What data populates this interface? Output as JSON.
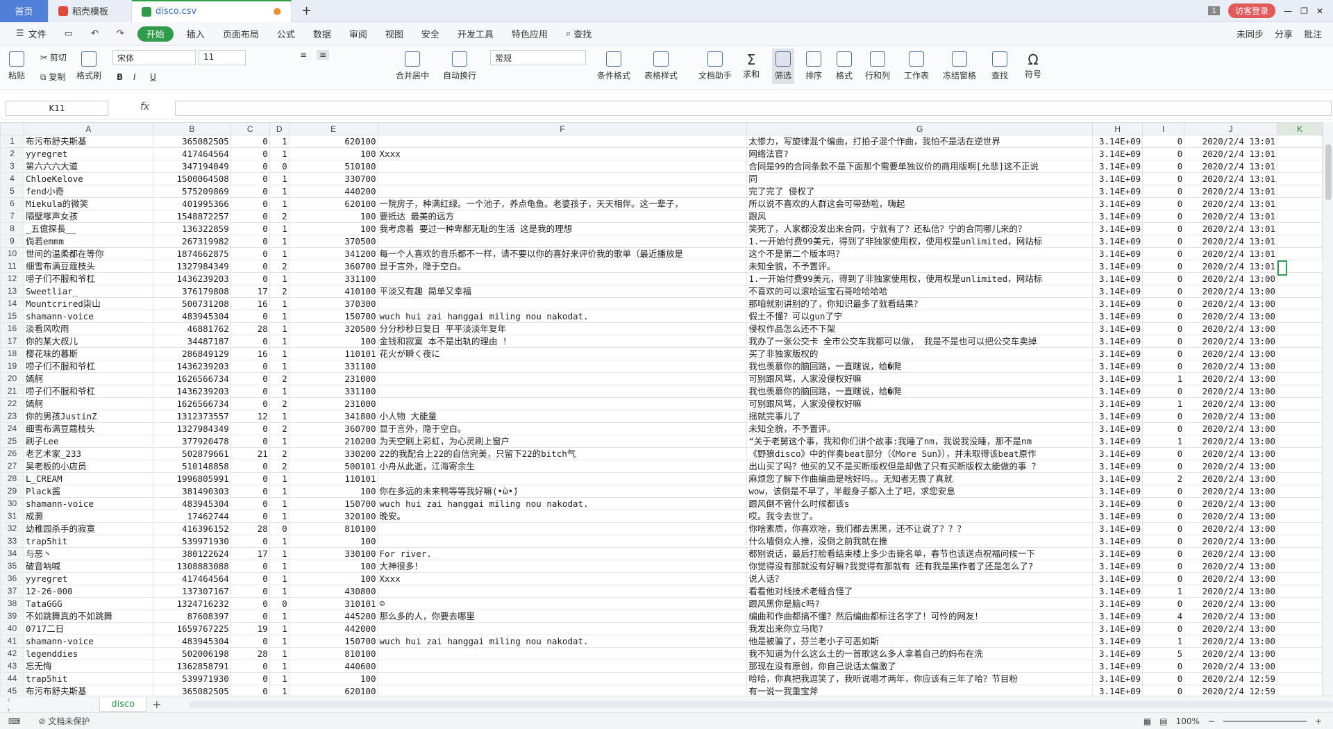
{
  "tabs": {
    "home": "首页",
    "template": "稻壳模板",
    "file": "disco.csv"
  },
  "titlebar": {
    "badge": "1",
    "login": "访客登录"
  },
  "menu": {
    "file": "文件",
    "items": [
      "开始",
      "插入",
      "页面布局",
      "公式",
      "数据",
      "审阅",
      "视图",
      "安全",
      "开发工具",
      "特色应用"
    ],
    "find": "查找",
    "right": [
      "未同步",
      "分享",
      "批注"
    ]
  },
  "ribbon": {
    "paste": "粘贴",
    "cut": "剪切",
    "copy": "复制",
    "format_painter": "格式刷",
    "font": "宋体",
    "size": "11",
    "number_format": "常规",
    "merge": "合并居中",
    "wrap": "自动换行",
    "cond": "条件格式",
    "table_fmt": "表格样式",
    "doc_helper": "文档助手",
    "sum": "求和",
    "filter": "筛选",
    "sort": "排序",
    "format": "格式",
    "rowcol": "行和列",
    "sheet": "工作表",
    "freeze": "冻结窗格",
    "find": "查找",
    "symbol": "符号"
  },
  "formula": {
    "namebox": "K11",
    "fx": "fx",
    "value": ""
  },
  "columns": [
    "A",
    "B",
    "C",
    "D",
    "E",
    "F",
    "G",
    "H",
    "I",
    "J",
    "K"
  ],
  "rows": [
    [
      "布污布舒夫斯基",
      "365082505",
      "0",
      "1",
      "620100",
      "",
      "太惨力，写旋律混个编曲，打拍子混个作曲，我怕不是活在逆世界",
      "3.14E+09",
      "0",
      "2020/2/4 13:01",
      ""
    ],
    [
      "yyregret",
      "417464564",
      "0",
      "1",
      "100",
      "Xxxx",
      "网络法官?",
      "3.14E+09",
      "0",
      "2020/2/4 13:01",
      ""
    ],
    [
      "第六六六大道",
      "347194049",
      "0",
      "0",
      "510100",
      "",
      "合同是99的合同条款不是下面那个需要单独议价的商用版啊[允悲]这不正说",
      "3.14E+09",
      "0",
      "2020/2/4 13:01",
      ""
    ],
    [
      "ChloeKelove",
      "1500064508",
      "0",
      "1",
      "330700",
      "",
      "同",
      "3.14E+09",
      "0",
      "2020/2/4 13:01",
      ""
    ],
    [
      "fend小奇",
      "575209869",
      "0",
      "1",
      "440200",
      "",
      "完了完了 侵权了",
      "3.14E+09",
      "0",
      "2020/2/4 13:01",
      ""
    ],
    [
      "Miekula的微笑",
      "401995366",
      "0",
      "1",
      "620100",
      "一院房子，种满红绿。一个池子，养点龟鱼。老婆孩子，天天相伴。这一辈子，",
      "所以说不喜欢的人群这会可带劲啦，嗨起",
      "3.14E+09",
      "0",
      "2020/2/4 13:01",
      ""
    ],
    [
      "隔壁嗲声女孩",
      "1548872257",
      "0",
      "2",
      "100",
      "要抵达 最美的远方",
      "跟风",
      "3.14E+09",
      "0",
      "2020/2/4 13:01",
      ""
    ],
    [
      "_五億探長__",
      "136322859",
      "0",
      "1",
      "100",
      "我考虑着 要过一种卑鄙无耻的生活 这是我的理想",
      "笑死了，人家都没发出来合同，宁就有了？还私信？宁的合同哪儿来的？",
      "3.14E+09",
      "0",
      "2020/2/4 13:01",
      ""
    ],
    [
      "倘若emmm",
      "267319982",
      "0",
      "1",
      "370500",
      "",
      "1.一开始付费99美元，得到了非独家使用权，使用权是unlimited，网站标",
      "3.14E+09",
      "0",
      "2020/2/4 13:01",
      ""
    ],
    [
      "世间的温柔都在等你",
      "1874662875",
      "0",
      "1",
      "341200",
      "每一个人喜欢的音乐都不一样，请不要以你的喜好来评价我的歌单（最近播放是",
      "这个不是第二个版本吗？",
      "3.14E+09",
      "0",
      "2020/2/4 13:01",
      ""
    ],
    [
      "细雪布满豆蔻枝头",
      "1327984349",
      "0",
      "2",
      "360700",
      "显于言外，隐于空白。",
      "未知全貌，不予置评。",
      "3.14E+09",
      "0",
      "2020/2/4 13:01",
      ""
    ],
    [
      "唠子们不服和爷杠",
      "1436239203",
      "0",
      "1",
      "331100",
      "",
      "1.一开始付费99美元，得到了非独家使用权，使用权是unlimited，网站标",
      "3.14E+09",
      "0",
      "2020/2/4 13:00",
      ""
    ],
    [
      "Sweetliar_",
      "376179808",
      "17",
      "2",
      "410100",
      "平淡又有趣 简单又幸福",
      "不喜欢的可以滚哈运宝石哥哈哈哈哈",
      "3.14E+09",
      "0",
      "2020/2/4 13:00",
      ""
    ],
    [
      "Mountcrired柒山",
      "500731208",
      "16",
      "1",
      "370300",
      "",
      "那咱就别讲别的了，你知识最多了就看结果？",
      "3.14E+09",
      "0",
      "2020/2/4 13:00",
      ""
    ],
    [
      "shamann-voice",
      "483945304",
      "0",
      "1",
      "150700",
      "wuch hui zai hanggai miling nou nakodat.",
      "假土不懂？可以gun了宁",
      "3.14E+09",
      "0",
      "2020/2/4 13:00",
      ""
    ],
    [
      "淡看风吹雨",
      "46881762",
      "28",
      "1",
      "320500",
      "分分秒秒日复日 平平淡淡年复年",
      "侵权作品怎么还不下架",
      "3.14E+09",
      "0",
      "2020/2/4 13:00",
      ""
    ],
    [
      "你的某大叔儿",
      "34487187",
      "0",
      "1",
      "100",
      "金钱和寂寞 本不是出轨的理由 ！",
      "我办了一张公交卡 全市公交车我都可以做， 我是不是也可以把公交车卖掉",
      "3.14E+09",
      "0",
      "2020/2/4 13:00",
      ""
    ],
    [
      "樱花味的暮斯",
      "286849129",
      "16",
      "1",
      "110101",
      "花火が瞬く夜に",
      "买了非独家版权的",
      "3.14E+09",
      "0",
      "2020/2/4 13:00",
      ""
    ],
    [
      "唠子们不服和爷杠",
      "1436239203",
      "0",
      "1",
      "331100",
      "",
      "我也羡慕你的脑回路，一直瞎说，给�爬",
      "3.14E+09",
      "0",
      "2020/2/4 13:00",
      ""
    ],
    [
      "嫣舸",
      "1626566734",
      "0",
      "2",
      "231000",
      "",
      "可别跟风骂，人家没侵权好嘛",
      "3.14E+09",
      "1",
      "2020/2/4 13:00",
      ""
    ],
    [
      "唠子们不服和爷杠",
      "1436239203",
      "0",
      "1",
      "331100",
      "",
      "我也羡慕你的脑回路，一直瞎说，给�爬",
      "3.14E+09",
      "0",
      "2020/2/4 13:00",
      ""
    ],
    [
      "嫣舸",
      "1626566734",
      "0",
      "2",
      "231000",
      "",
      "可别跟风骂，人家没侵权好嘛",
      "3.14E+09",
      "1",
      "2020/2/4 13:00",
      ""
    ],
    [
      "你的男孩JustinZ",
      "1312373557",
      "12",
      "1",
      "341800",
      "小人物 大能量",
      "摇就完事儿了",
      "3.14E+09",
      "0",
      "2020/2/4 13:00",
      ""
    ],
    [
      "细雪布满豆蔻枝头",
      "1327984349",
      "0",
      "2",
      "360700",
      "显于言外，隐于空白。",
      "未知全貌，不予置评。",
      "3.14E+09",
      "0",
      "2020/2/4 13:00",
      ""
    ],
    [
      "刷子Lee",
      "377920478",
      "0",
      "1",
      "210200",
      "为天空刷上彩虹，为心灵刷上窗户",
      "“关于老舅这个事，我和你们讲个故事:我睡了nm，我说我没睡，那不是nm",
      "3.14E+09",
      "1",
      "2020/2/4 13:00",
      ""
    ],
    [
      "老艺术家_233",
      "502879661",
      "21",
      "2",
      "330200",
      "22的我配合上22的自信完美，只留下22的bitch气",
      "《野狼disco》中的伴奏beat部分（《More Sun》），并未取得该beat原作",
      "3.14E+09",
      "0",
      "2020/2/4 13:00",
      ""
    ],
    [
      "吴老板的小店员",
      "510148858",
      "0",
      "2",
      "500101",
      "小舟从此逝，江海寄余生",
      "出山买了吗？他买的又不是买断版权但是却做了只有买断版权太能做的事 ？",
      "3.14E+09",
      "0",
      "2020/2/4 13:00",
      ""
    ],
    [
      "L_CREAM",
      "1996805991",
      "0",
      "1",
      "110101",
      "",
      "麻烦您了解下作曲编曲是啥好吗。。无知者无畏了真就",
      "3.14E+09",
      "2",
      "2020/2/4 13:00",
      ""
    ],
    [
      "Plack酱",
      "381490303",
      "0",
      "1",
      "100",
      "你在多远的未来鸭等等我好嘛(•̀ω•́)",
      "wow，该倒是不早了，半截身子都入土了吧，求您安息",
      "3.14E+09",
      "0",
      "2020/2/4 13:00",
      ""
    ],
    [
      "shamann-voice",
      "483945304",
      "0",
      "1",
      "150700",
      "wuch hui zai hanggai miling nou nakodat.",
      "跟风倒不管什么时候都该s",
      "3.14E+09",
      "0",
      "2020/2/4 13:00",
      ""
    ],
    [
      "成灏",
      "17462744",
      "0",
      "1",
      "320100",
      "晚安。",
      "哎。我令去世了。",
      "3.14E+09",
      "0",
      "2020/2/4 13:00",
      ""
    ],
    [
      "幼稚园杀手的寂寞",
      "416396152",
      "28",
      "0",
      "810100",
      "",
      "你啥素质，你喜欢啥，我们都去黑黑，还不让说了？？？",
      "3.14E+09",
      "0",
      "2020/2/4 13:00",
      ""
    ],
    [
      "trap5hit",
      "539971930",
      "0",
      "1",
      "100",
      "",
      "什么墙倒众人推，没倒之前我就在推",
      "3.14E+09",
      "0",
      "2020/2/4 13:00",
      ""
    ],
    [
      "与恶丶",
      "380122624",
      "17",
      "1",
      "330100",
      "For river.",
      "都别说话，最后打脸看结束楼上多少击毙名单，春节也该送点祝福问候一下",
      "3.14E+09",
      "0",
      "2020/2/4 13:00",
      ""
    ],
    [
      "破音呐喊",
      "1308883088",
      "0",
      "1",
      "100",
      "大神很多！",
      "你觉得没有那就没有好嘛?我觉得有那就有 还有我是黑作者了还是怎么了?",
      "3.14E+09",
      "0",
      "2020/2/4 13:00",
      ""
    ],
    [
      "yyregret",
      "417464564",
      "0",
      "1",
      "100",
      "Xxxx",
      "说人话？",
      "3.14E+09",
      "0",
      "2020/2/4 13:00",
      ""
    ],
    [
      "12-26-000",
      "137307167",
      "0",
      "1",
      "430800",
      "",
      "看看他对线技术老缝合怪了",
      "3.14E+09",
      "1",
      "2020/2/4 13:00",
      ""
    ],
    [
      "TataGGG",
      "1324716232",
      "0",
      "0",
      "310101",
      "☺",
      "跟风黑你是脑c吗?",
      "3.14E+09",
      "0",
      "2020/2/4 13:00",
      ""
    ],
    [
      "不如跳舞真的不如跳舞",
      "87608397",
      "0",
      "1",
      "445200",
      "那么多的人，你要去哪里",
      "编曲和作曲都搞不懂？然后编曲都标注名字了！可怜的网友！",
      "3.14E+09",
      "4",
      "2020/2/4 13:00",
      ""
    ],
    [
      "0717二日",
      "1659767225",
      "19",
      "1",
      "442000",
      "",
      "我发出来你立马爬?",
      "3.14E+09",
      "0",
      "2020/2/4 13:00",
      ""
    ],
    [
      "shamann-voice",
      "483945304",
      "0",
      "1",
      "150700",
      "wuch hui zai hanggai miling nou nakodat.",
      "他是被骗了，芬兰老小子可恶如斯",
      "3.14E+09",
      "1",
      "2020/2/4 13:00",
      ""
    ],
    [
      "legenddies",
      "502006198",
      "28",
      "1",
      "810100",
      "",
      "我不知道为什么这么土的一首歌这么多人拿着自己的妈布在洗",
      "3.14E+09",
      "5",
      "2020/2/4 13:00",
      ""
    ],
    [
      "忘无悔",
      "1362858791",
      "0",
      "1",
      "440600",
      "",
      "那现在没有原创，你自己说话太偏激了",
      "3.14E+09",
      "0",
      "2020/2/4 13:00",
      ""
    ],
    [
      "trap5hit",
      "539971930",
      "0",
      "1",
      "100",
      "",
      "哈哈，你真把我逗笑了，我听说唱才两年，你应该有三年了哈？节目粉",
      "3.14E+09",
      "0",
      "2020/2/4 12:59",
      ""
    ],
    [
      "布污布舒夫斯基",
      "365082505",
      "0",
      "1",
      "620100",
      "",
      "有一说一我重宝斧",
      "3.14E+09",
      "0",
      "2020/2/4 12:59",
      ""
    ]
  ],
  "sheet": {
    "name": "disco"
  },
  "status": {
    "protect": "文档未保护",
    "zoom": "100%"
  }
}
